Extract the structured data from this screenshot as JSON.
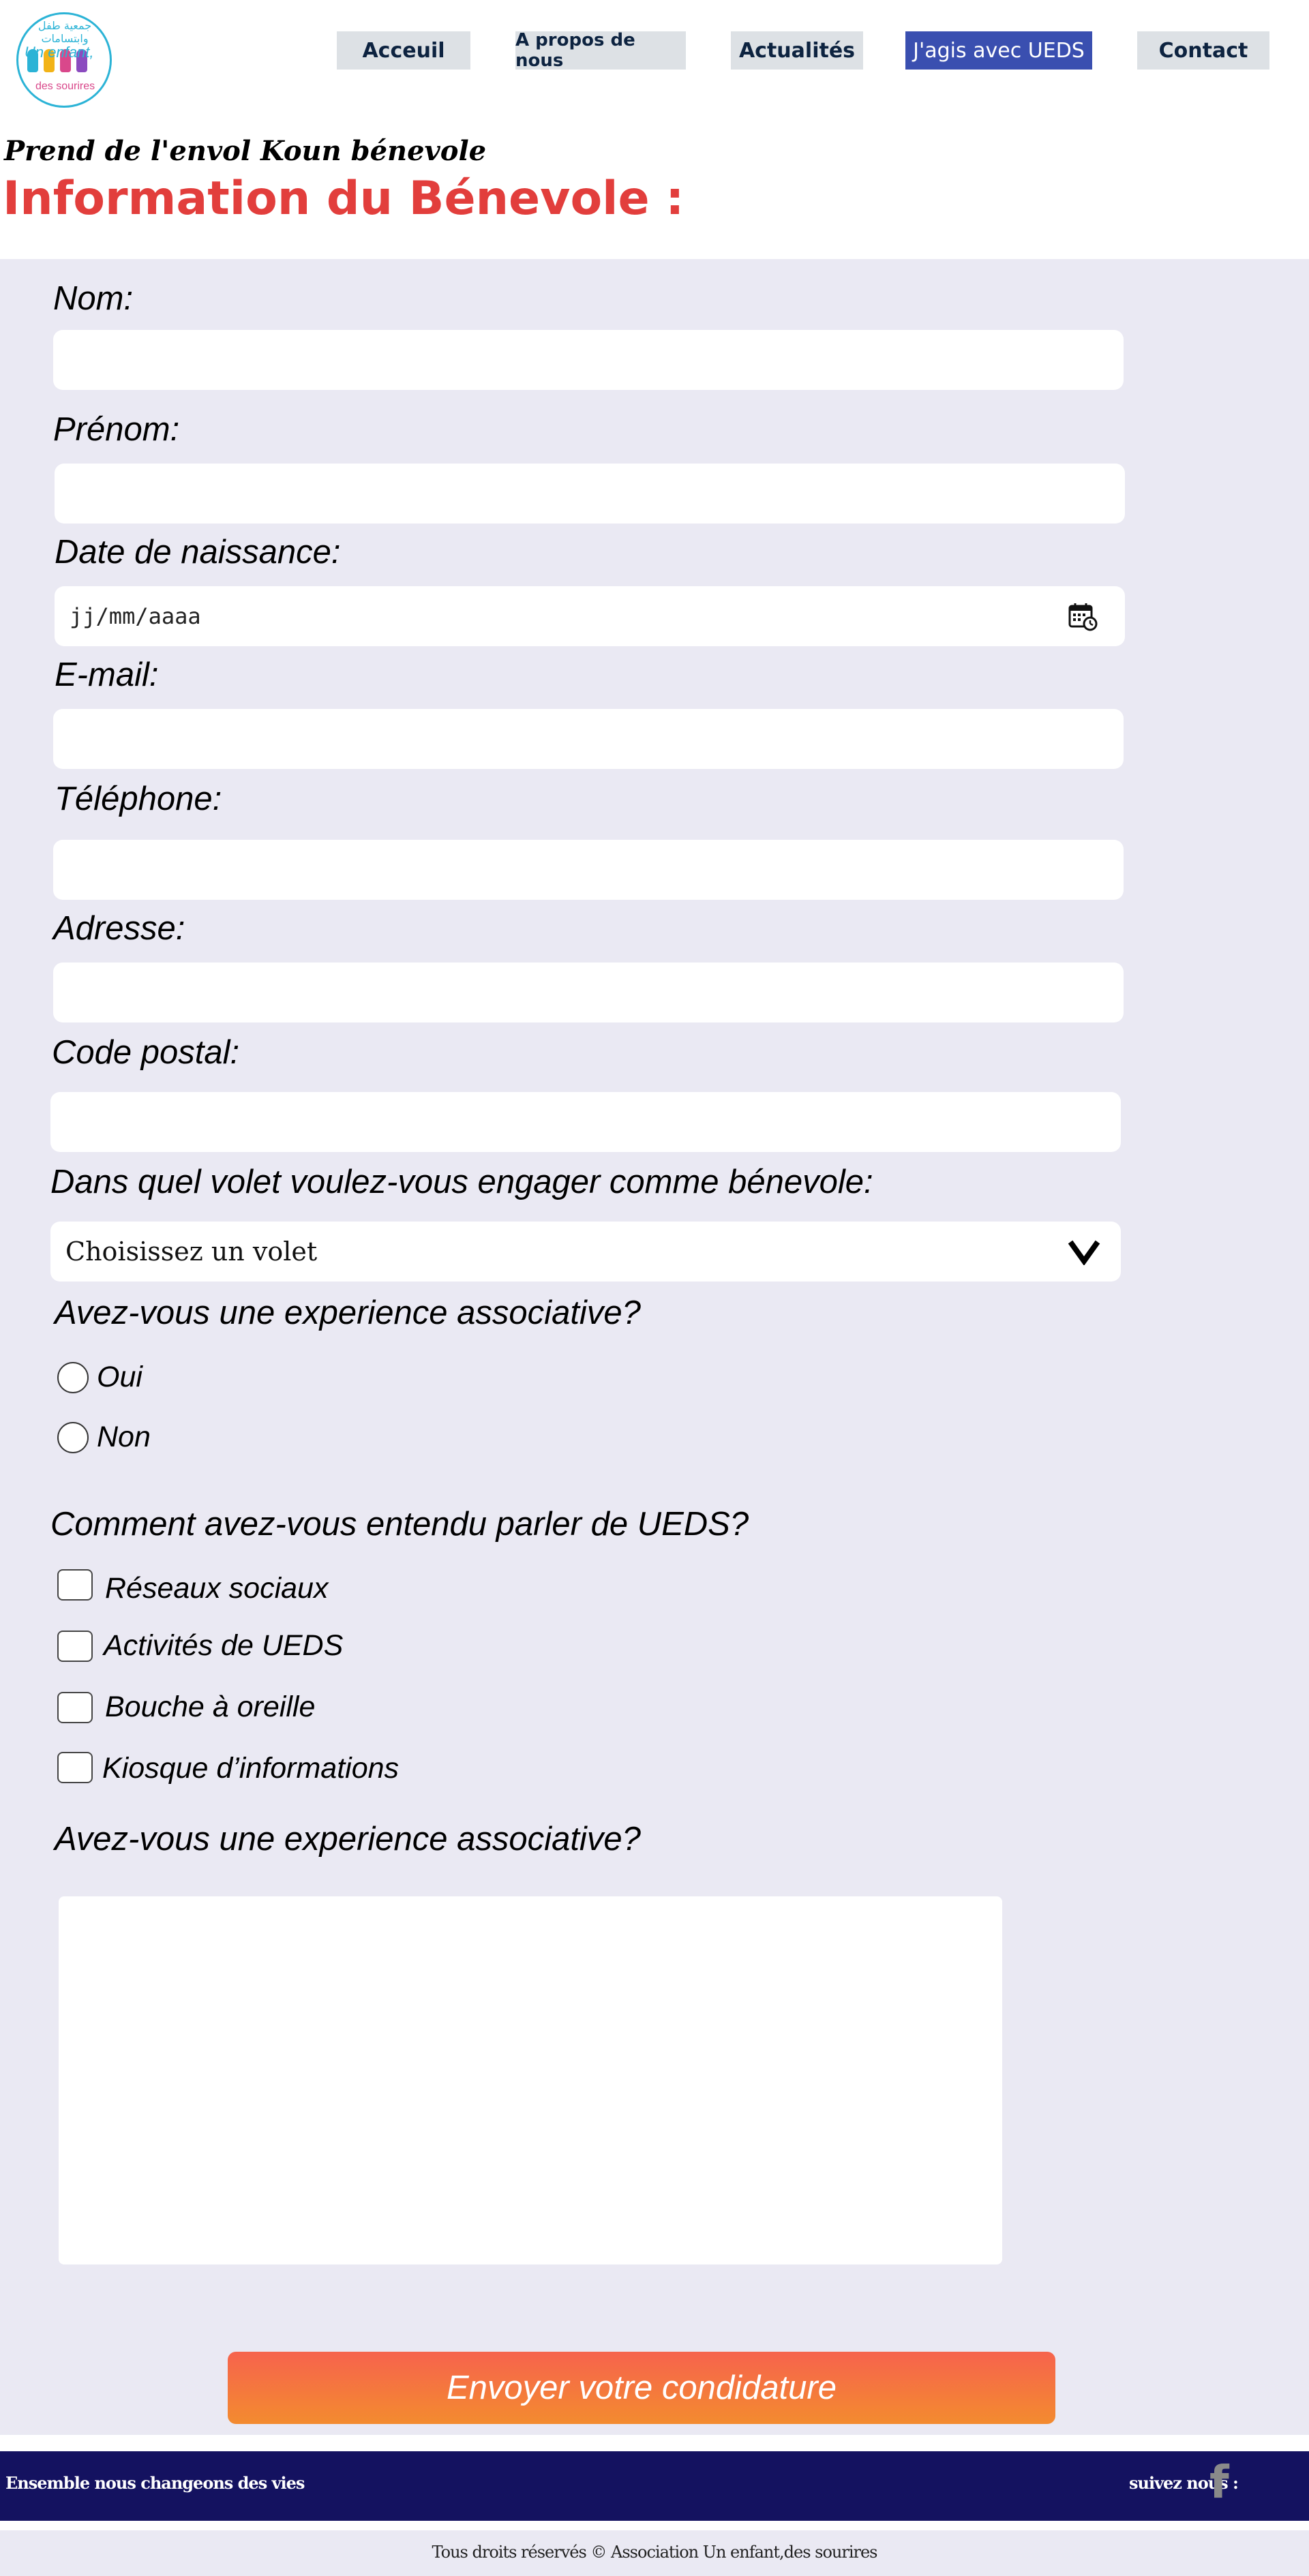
{
  "header": {
    "logo": {
      "arabic_text": "جمعية طفل وابتسامات",
      "name_line1": "Un enfant,",
      "name_line2": "des sourires"
    },
    "nav": [
      {
        "label": "Acceuil"
      },
      {
        "label": "A propos de nous"
      },
      {
        "label": "Actualités"
      },
      {
        "label": "J'agis avec UEDS"
      },
      {
        "label": "Contact"
      }
    ]
  },
  "page": {
    "tagline": "Prend de l'envol Koun bénevole",
    "title": "Information du Bénevole :"
  },
  "form": {
    "nom_label": "Nom:",
    "nom_value": "",
    "prenom_label": "Prénom:",
    "prenom_value": "",
    "dob_label": "Date de naissance:",
    "dob_placeholder": "jj/mm/aaaa",
    "email_label": "E-mail:",
    "email_value": "",
    "telephone_label": "Téléphone:",
    "telephone_value": "",
    "adresse_label": "Adresse:",
    "adresse_value": "",
    "code_postal_label": "Code postal:",
    "code_postal_value": "",
    "volet_label": "Dans quel volet voulez-vous engager comme bénevole:",
    "volet_selected": "Choisissez un volet",
    "experience_label": "Avez-vous une experience associative?",
    "experience_options": [
      "Oui",
      "Non"
    ],
    "source_label": "Comment avez-vous entendu parler de UEDS?",
    "source_options": [
      "Réseaux sociaux",
      "Activités de UEDS",
      "Bouche à oreille",
      "Kiosque d’informations"
    ],
    "experience2_label": "Avez-vous une experience associative?",
    "experience2_value": "",
    "submit_label": "Envoyer votre condidature"
  },
  "footer": {
    "slogan": "Ensemble nous changeons des vies",
    "follow_label": "suivez nous :",
    "facebook_icon": "f",
    "copyright": "Tous droits réservés © Association Un enfant,des sourires"
  },
  "colors": {
    "title_red": "#e23e3c",
    "nav_active": "#3a4fb0",
    "panel_bg": "#eae9f3",
    "footer_bg": "#141260",
    "submit_gradient_top": "#f6634d",
    "submit_gradient_bottom": "#f38b2f"
  }
}
